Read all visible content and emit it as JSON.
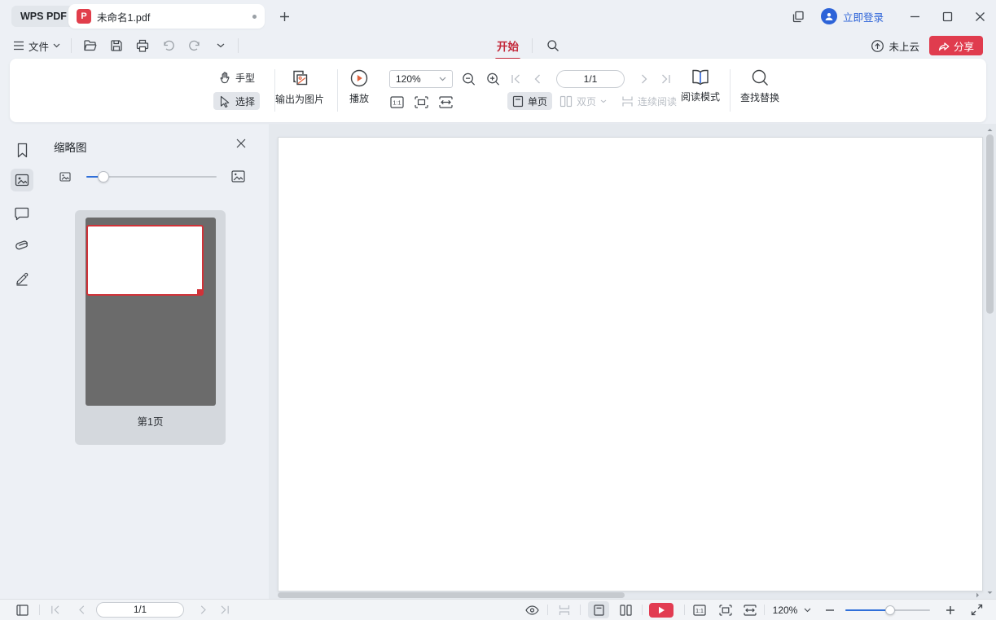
{
  "app": {
    "name": "WPS PDF"
  },
  "titlebar": {
    "tab_title": "未命名1.pdf",
    "pdf_badge": "P",
    "login": "立即登录"
  },
  "menubar": {
    "file": "文件",
    "home_tab": "开始",
    "cloud": "未上云",
    "share": "分享"
  },
  "ribbon": {
    "hand": "手型",
    "select": "选择",
    "export_image": "输出为图片",
    "play": "播放",
    "zoom_value": "120%",
    "page_indicator": "1/1",
    "single_page": "单页",
    "two_page": "双页",
    "continuous": "连续阅读",
    "read_mode": "阅读模式",
    "find_replace": "查找替换",
    "one_to_one": "1:1"
  },
  "panel": {
    "title": "缩略图",
    "page_label": "第1页"
  },
  "statusbar": {
    "page_indicator": "1/1",
    "zoom_value": "120%",
    "one_to_one": "1:1"
  },
  "colors": {
    "accent_red": "#e03c4e",
    "brand_blue": "#2d63d8",
    "slider_blue": "#2f6fd9",
    "home_tab_red": "#c4293b",
    "viewport_red": "#d03238"
  }
}
